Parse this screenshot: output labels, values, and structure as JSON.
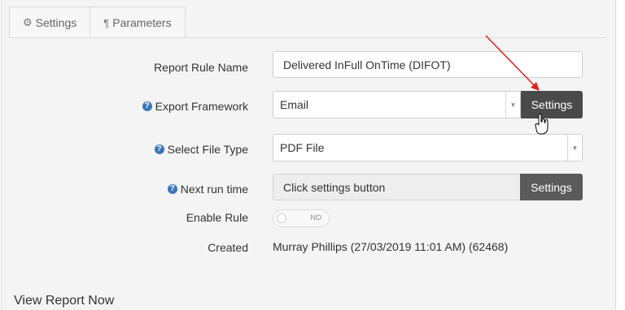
{
  "tabs": [
    {
      "label": "Settings",
      "icon": "gear-icon"
    },
    {
      "label": "Parameters",
      "icon": "pilcrow-icon"
    }
  ],
  "form": {
    "report_rule_name": {
      "label": "Report Rule Name",
      "value": "Delivered InFull OnTime (DIFOT)"
    },
    "export_framework": {
      "label": "Export Framework",
      "value": "Email",
      "button": "Settings"
    },
    "file_type": {
      "label": "Select File Type",
      "value": "PDF File"
    },
    "next_run_time": {
      "label": "Next run time",
      "value": "Click settings button",
      "button": "Settings"
    },
    "enable_rule": {
      "label": "Enable Rule",
      "state": "NO"
    },
    "created": {
      "label": "Created",
      "value": "Murray Phillips (27/03/2019 11:01 AM) (62468)"
    }
  },
  "section": {
    "title": "View Report Now"
  },
  "colors": {
    "accent": "#3a77b8",
    "button_dark": "#4a4a4a",
    "annotation_arrow": "#e02020"
  }
}
